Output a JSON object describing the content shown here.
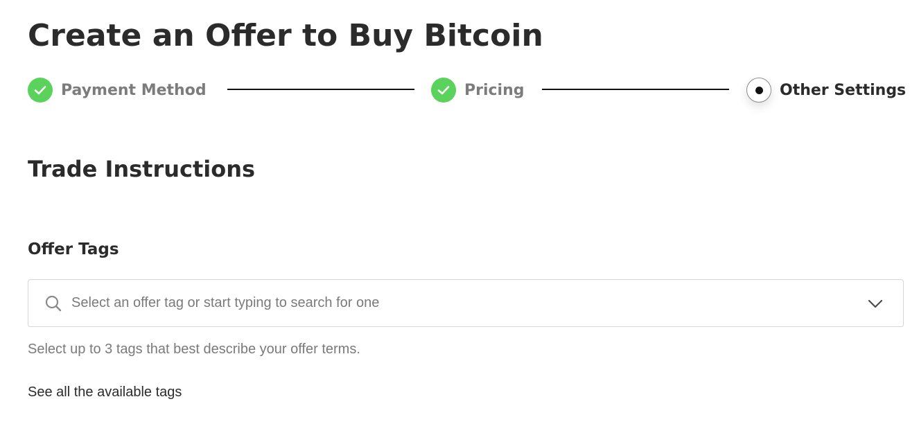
{
  "page": {
    "title": "Create an Offer to Buy Bitcoin"
  },
  "stepper": {
    "steps": [
      {
        "label": "Payment Method",
        "status": "completed",
        "icon": "check-icon"
      },
      {
        "label": "Pricing",
        "status": "completed",
        "icon": "check-icon"
      },
      {
        "label": "Other Settings",
        "status": "current",
        "icon": "dot-icon"
      }
    ]
  },
  "trade_instructions": {
    "title": "Trade Instructions"
  },
  "offer_tags": {
    "title": "Offer Tags",
    "select_placeholder": "Select an offer tag or start typing to search for one",
    "helper_text": "Select up to 3 tags that best describe your offer terms.",
    "all_tags_link": "See all the available tags"
  },
  "colors": {
    "completed_step": "#5bd25b",
    "text_primary": "#2b2b2b",
    "text_muted": "#7a7a7a",
    "connector": "#111111",
    "input_border": "#d6d6d6"
  }
}
